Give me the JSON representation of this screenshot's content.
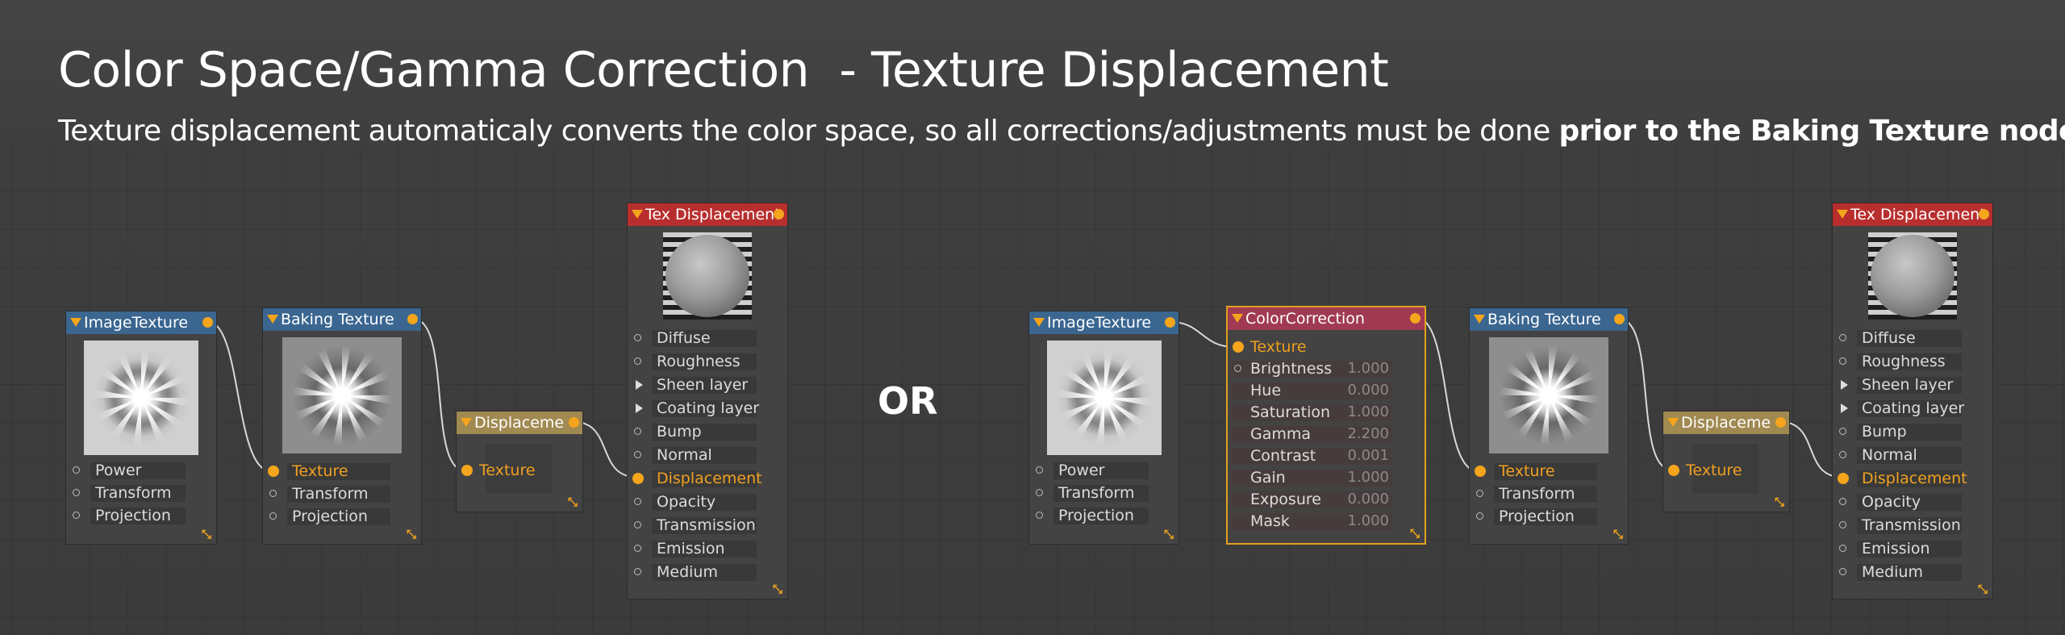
{
  "title": "Color Space/Gamma Correction  - Texture Displacement",
  "subtitle": {
    "normal": "Texture displacement automaticaly converts the color space, so all corrections/adjustments must be done ",
    "bold": "prior to the Baking Texture node"
  },
  "separator": "OR",
  "colors": {
    "accent": "#f4a51c",
    "image_texture_header": "#3a6690",
    "baking_texture_header": "#3a6690",
    "displacement_header": "#a08a52",
    "tex_displacement_header": "#b82e2e",
    "color_correction_header": "#a03a52"
  },
  "left_graph": {
    "image_texture": {
      "title": "ImageTexture",
      "ports": [
        "Power",
        "Transform",
        "Projection"
      ]
    },
    "baking_texture": {
      "title": "Baking Texture",
      "ports": [
        "Texture",
        "Transform",
        "Projection"
      ]
    },
    "displacement": {
      "title": "Displaceme",
      "ports": [
        "Texture"
      ]
    },
    "tex_displacement": {
      "title": "Tex Displacement",
      "ports": [
        "Diffuse",
        "Roughness",
        "Sheen layer",
        "Coating layer",
        "Bump",
        "Normal",
        "Displacement",
        "Opacity",
        "Transmission",
        "Emission",
        "Medium"
      ]
    }
  },
  "right_graph": {
    "image_texture": {
      "title": "ImageTexture",
      "ports": [
        "Power",
        "Transform",
        "Projection"
      ]
    },
    "color_correction": {
      "title": "ColorCorrection",
      "ports": [
        {
          "label": "Texture",
          "value": ""
        },
        {
          "label": "Brightness",
          "value": "1.000"
        },
        {
          "label": "Hue",
          "value": "0.000"
        },
        {
          "label": "Saturation",
          "value": "1.000"
        },
        {
          "label": "Gamma",
          "value": "2.200"
        },
        {
          "label": "Contrast",
          "value": "0.001"
        },
        {
          "label": "Gain",
          "value": "1.000"
        },
        {
          "label": "Exposure",
          "value": "0.000"
        },
        {
          "label": "Mask",
          "value": "1.000"
        }
      ]
    },
    "baking_texture": {
      "title": "Baking Texture",
      "ports": [
        "Texture",
        "Transform",
        "Projection"
      ]
    },
    "displacement": {
      "title": "Displaceme",
      "ports": [
        "Texture"
      ]
    },
    "tex_displacement": {
      "title": "Tex Displacement",
      "ports": [
        "Diffuse",
        "Roughness",
        "Sheen layer",
        "Coating layer",
        "Bump",
        "Normal",
        "Displacement",
        "Opacity",
        "Transmission",
        "Emission",
        "Medium"
      ]
    }
  }
}
